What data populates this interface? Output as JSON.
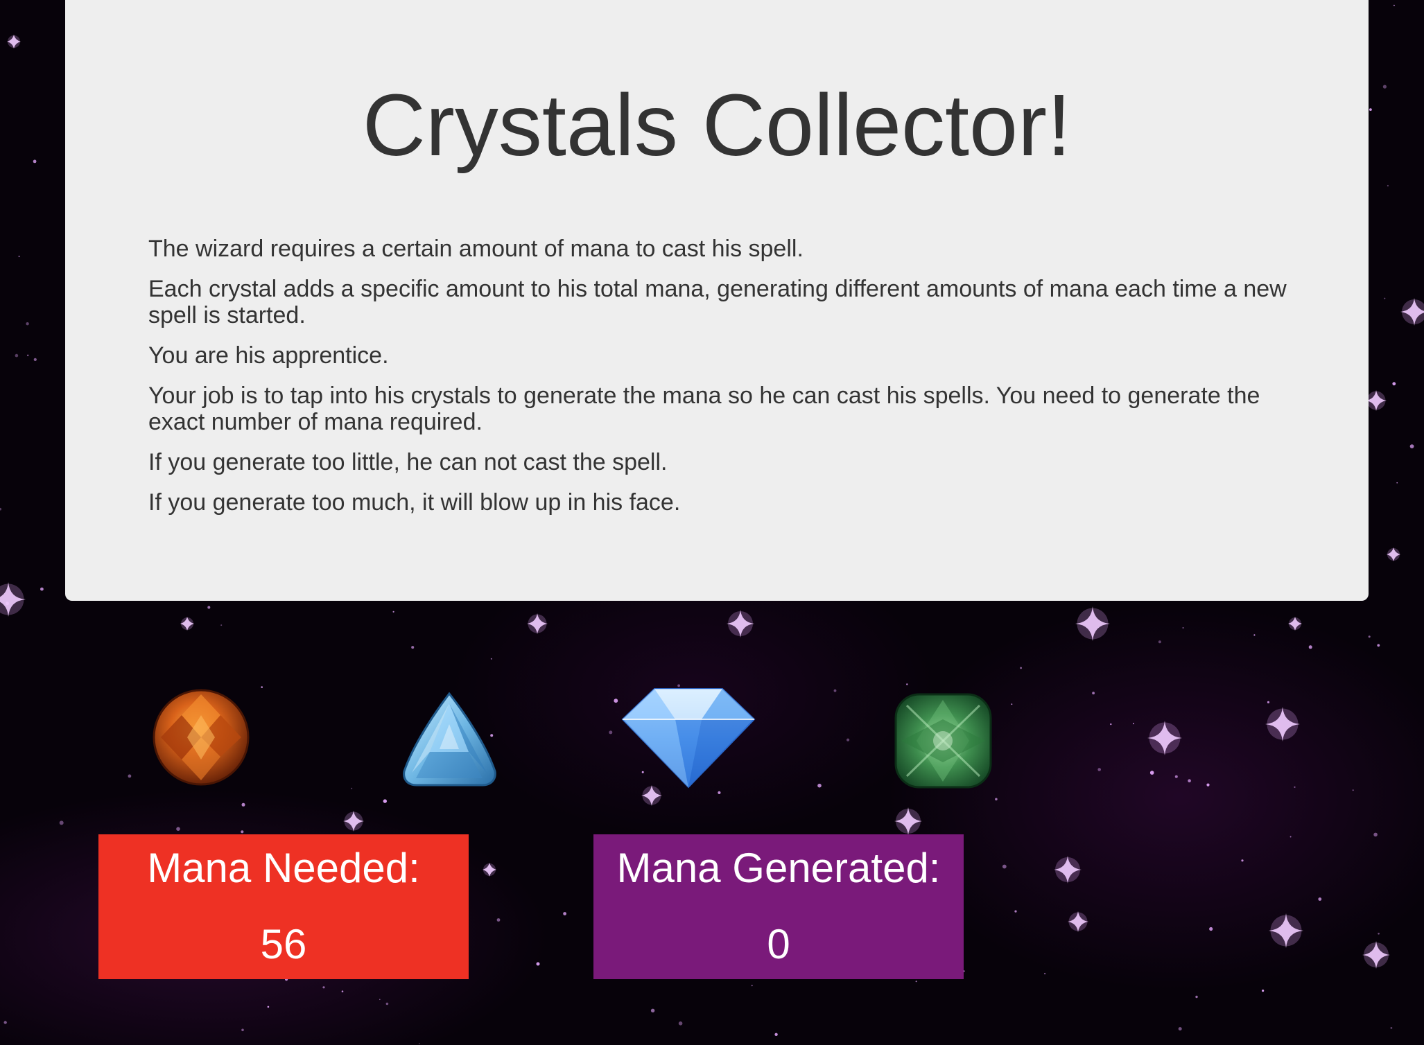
{
  "title": "Crystals Collector!",
  "instructions": [
    "The wizard requires a certain amount of mana to cast his spell.",
    "Each crystal adds a specific amount to his total mana, generating different amounts of mana each time a new spell is started.",
    "You are his apprentice.",
    "Your job is to tap into his crystals to generate the mana so he can cast his spells. You need to generate the exact number of mana required.",
    "If you generate too little, he can not cast the spell.",
    "If you generate too much, it will blow up in his face."
  ],
  "crystals": [
    {
      "icon": "orange-round-crystal-icon",
      "color": "#d2601a"
    },
    {
      "icon": "light-blue-trillion-crystal-icon",
      "color": "#7ec3ea"
    },
    {
      "icon": "blue-diamond-crystal-icon",
      "color": "#5aa0f0"
    },
    {
      "icon": "green-cushion-crystal-icon",
      "color": "#3f8f4f"
    }
  ],
  "mana_needed": {
    "label": "Mana Needed:",
    "value": "56",
    "color": "#ee3124"
  },
  "mana_generated": {
    "label": "Mana Generated:",
    "value": "0",
    "color": "#7a1a7a"
  },
  "background": {
    "base_color": "#07020a",
    "star_color": "#e6a8ff"
  }
}
